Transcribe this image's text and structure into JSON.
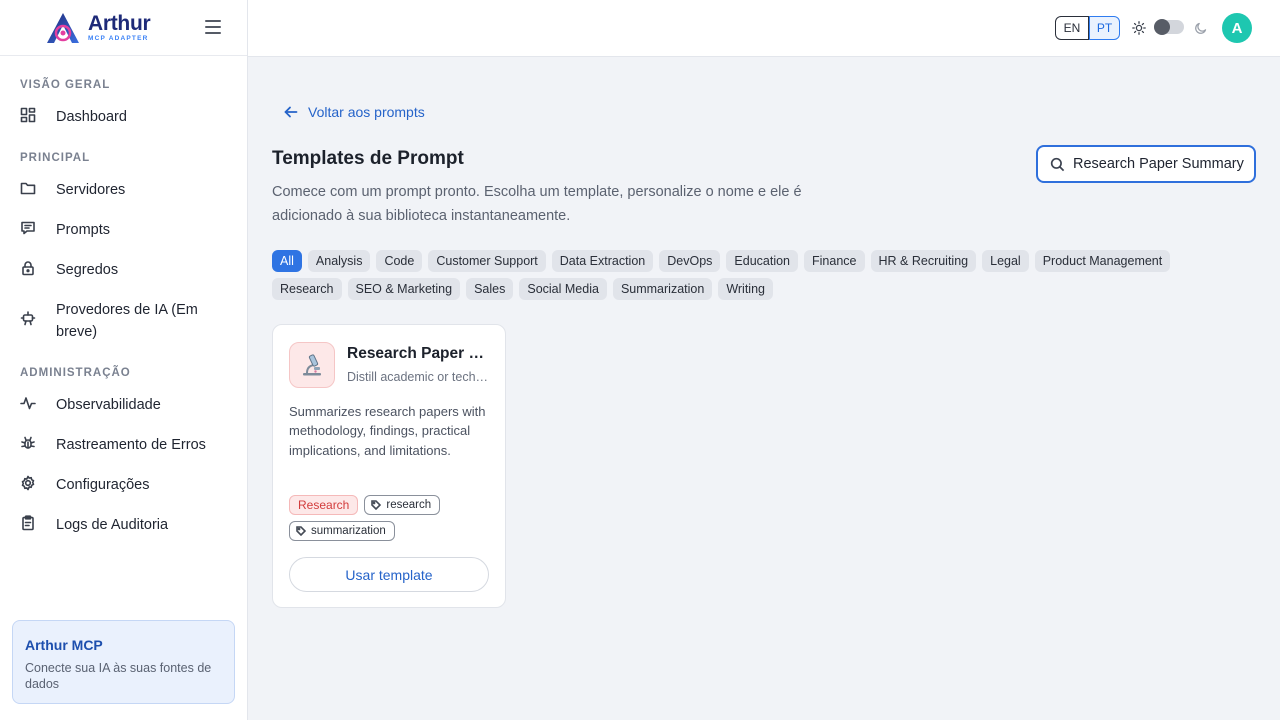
{
  "brand": {
    "name": "Arthur",
    "subtitle": "MCP ADAPTER"
  },
  "sidebar": {
    "sections": [
      {
        "label": "VISÃO GERAL"
      },
      {
        "label": "PRINCIPAL"
      },
      {
        "label": "ADMINISTRAÇÃO"
      }
    ],
    "items": [
      {
        "label": "Dashboard",
        "icon": "dashboard-icon"
      },
      {
        "label": "Servidores",
        "icon": "folder-icon"
      },
      {
        "label": "Prompts",
        "icon": "message-icon"
      },
      {
        "label": "Segredos",
        "icon": "lock-icon"
      },
      {
        "label": "Provedores de IA (Em breve)",
        "icon": "robot-icon"
      },
      {
        "label": "Observabilidade",
        "icon": "activity-icon"
      },
      {
        "label": "Rastreamento de Erros",
        "icon": "bug-icon"
      },
      {
        "label": "Configurações",
        "icon": "gear-icon"
      },
      {
        "label": "Logs de Auditoria",
        "icon": "clipboard-icon"
      }
    ],
    "promo": {
      "title": "Arthur MCP",
      "description": "Conecte sua IA às suas fontes de dados"
    }
  },
  "topbar": {
    "lang_en": "EN",
    "lang_pt": "PT",
    "avatar_initial": "A"
  },
  "main": {
    "back_label": "Voltar aos prompts",
    "title": "Templates de Prompt",
    "description": "Comece com um prompt pronto. Escolha um template, personalize o nome e ele é adicionado à sua biblioteca instantaneamente.",
    "search": {
      "value": "Research Paper Summary",
      "placeholder": ""
    },
    "filters": [
      "All",
      "Analysis",
      "Code",
      "Customer Support",
      "Data Extraction",
      "DevOps",
      "Education",
      "Finance",
      "HR & Recruiting",
      "Legal",
      "Product Management",
      "Research",
      "SEO & Marketing",
      "Sales",
      "Social Media",
      "Summarization",
      "Writing"
    ],
    "active_filter": "All",
    "card": {
      "title": "Research Paper Summary",
      "subtitle": "Distill academic or technical papers",
      "description": "Summarizes research papers with methodology, findings, practical implications, and limitations.",
      "category": "Research",
      "tags": [
        "research",
        "summarization"
      ],
      "button_label": "Usar template",
      "icon": "microscope-icon"
    }
  },
  "colors": {
    "accent": "#2f74e3",
    "brand": "#1e2a78",
    "avatar": "#1ec7b0",
    "category": "#d23c3c"
  }
}
